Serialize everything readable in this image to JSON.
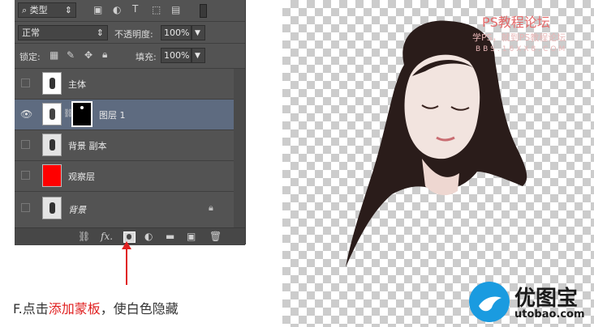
{
  "filter": {
    "label": "类型"
  },
  "blend": {
    "mode": "正常",
    "opacity_label": "不透明度:",
    "opacity_value": "100%"
  },
  "lock": {
    "label": "锁定:",
    "fill_label": "填充:",
    "fill_value": "100%"
  },
  "layers": [
    {
      "name": "主体"
    },
    {
      "name": "图层 1"
    },
    {
      "name": "背景 副本"
    },
    {
      "name": "观察层"
    },
    {
      "name": "背景"
    }
  ],
  "bottom_bar": {
    "fx_label": "fx."
  },
  "instruction": {
    "prefix": "F.点击",
    "highlight": "添加蒙板",
    "suffix": "，使白色隐藏"
  },
  "watermark": {
    "line1": "PS教程论坛",
    "line2": "学PS，就到PS教程论坛",
    "line3": "BBS.16XX8.COM"
  },
  "logo": {
    "name": "优图宝",
    "url": "utobao.com"
  },
  "colors": {
    "panel": "#535353",
    "selected_layer": "#5e6b80",
    "highlight_text": "#e02020",
    "observe_layer": "#ff0000",
    "logo_blue": "#1a9be0"
  }
}
